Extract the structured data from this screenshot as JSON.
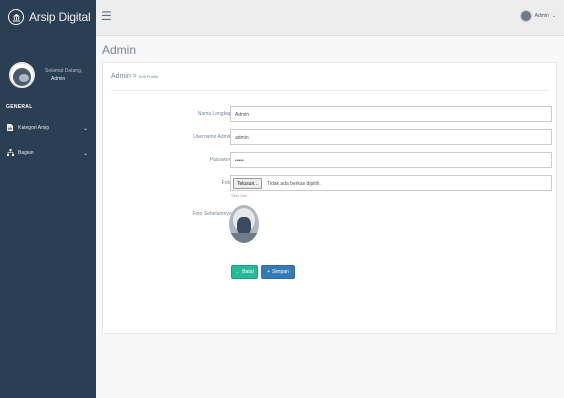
{
  "app": {
    "title": "Arsip Digital"
  },
  "sidebar": {
    "greeting": "Selamat Datang,",
    "user_name": "Admin",
    "section_label": "GENERAL",
    "items": [
      {
        "label": "Kategori Arsip",
        "icon": "file-icon"
      },
      {
        "label": "Bagian",
        "icon": "sitemap-icon"
      }
    ]
  },
  "topnav": {
    "user_label": "Admin"
  },
  "page": {
    "title": "Admin",
    "breadcrumb_main": "Admin >",
    "breadcrumb_sub": "Edit Profile"
  },
  "form": {
    "nama_label": "Nama Lengkap",
    "nama_value": "Admin",
    "username_label": "Username Admin",
    "username_value": "admin",
    "password_label": "Password",
    "password_value": "•••••",
    "foto_label": "Foto",
    "file_button": "Telusuri...",
    "file_status": "Tidak ada berkas dipilih.",
    "help_text": "*Max 2mb",
    "prev_photo_label": "Foto Sebelumnya",
    "required_mark": "*"
  },
  "buttons": {
    "back": "Batal",
    "save": "Simpan"
  },
  "colors": {
    "sidebar": "#2a3f54",
    "back_btn": "#26b99a",
    "save_btn": "#337ab7"
  }
}
